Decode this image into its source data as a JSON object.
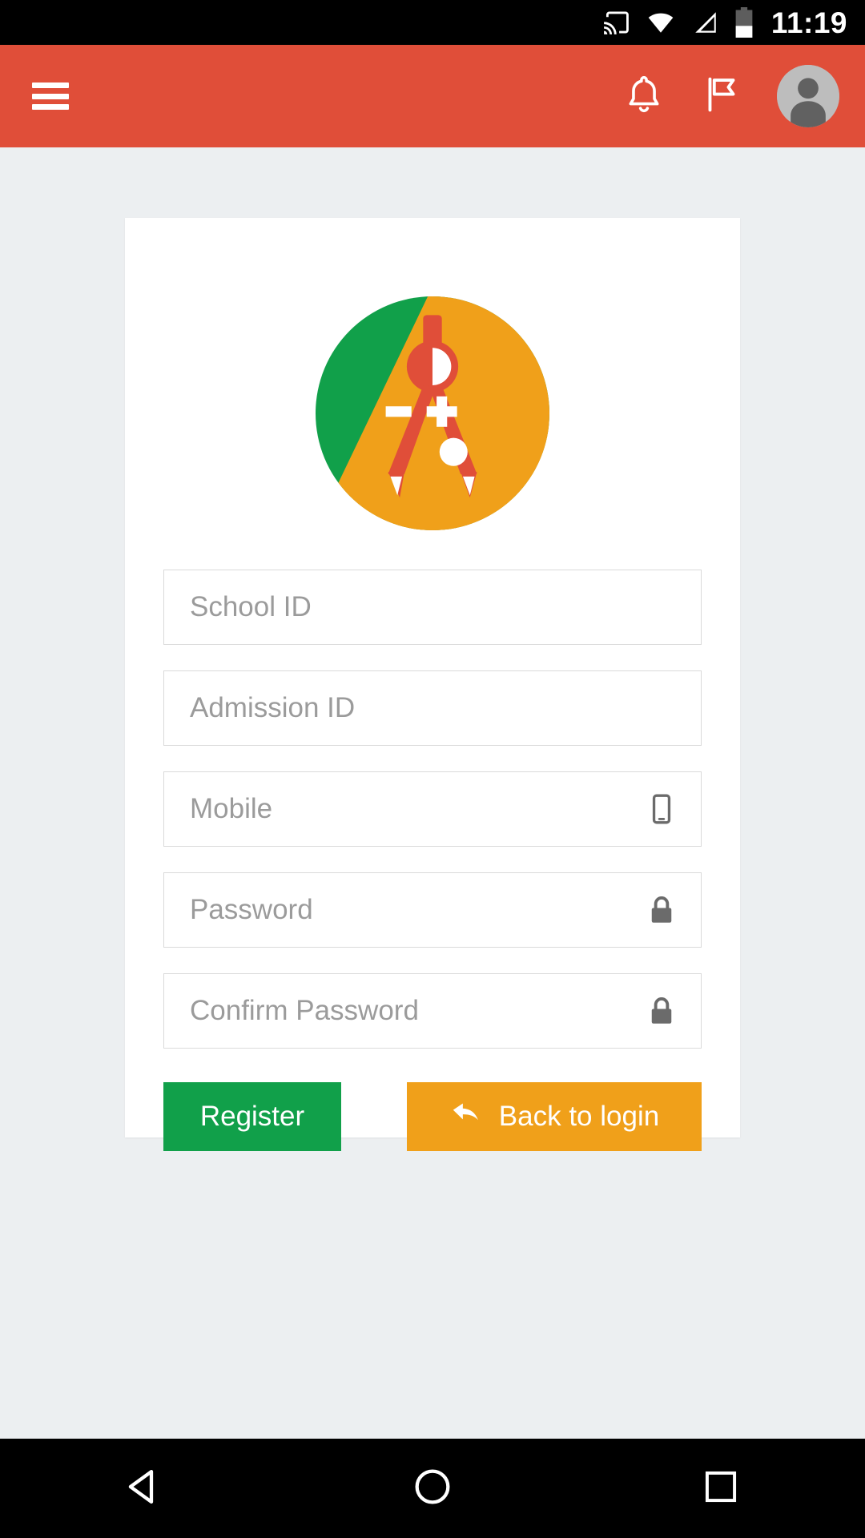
{
  "status_bar": {
    "time": "11:19",
    "icons": [
      "cast-icon",
      "wifi-icon",
      "signal-icon",
      "battery-icon"
    ],
    "battery_level_percent": 40,
    "background_color": "#000000"
  },
  "app_bar": {
    "background_color": "#e04e39",
    "menu_icon": "hamburger-menu-icon",
    "actions": [
      {
        "icon": "notification-bell-icon"
      },
      {
        "icon": "flag-icon"
      },
      {
        "icon": "user-avatar-icon"
      }
    ]
  },
  "card": {
    "logo": {
      "name": "compass-logo",
      "green": "#11a04a",
      "orange": "#f0a01a",
      "red": "#e04e39"
    },
    "fields": [
      {
        "name": "school-id",
        "placeholder": "School ID",
        "value": "",
        "type": "text",
        "icon": null
      },
      {
        "name": "admission-id",
        "placeholder": "Admission ID",
        "value": "",
        "type": "text",
        "icon": null
      },
      {
        "name": "mobile",
        "placeholder": "Mobile",
        "value": "",
        "type": "tel",
        "icon": "mobile-phone-icon"
      },
      {
        "name": "password",
        "placeholder": "Password",
        "value": "",
        "type": "password",
        "icon": "lock-icon"
      },
      {
        "name": "confirm-password",
        "placeholder": "Confirm Password",
        "value": "",
        "type": "password",
        "icon": "lock-icon"
      }
    ],
    "buttons": {
      "register": {
        "label": "Register",
        "color": "#11a04a"
      },
      "back_to_login": {
        "label": "Back to login",
        "color": "#f0a01a",
        "icon": "back-arrow-icon"
      }
    }
  },
  "nav_bar": {
    "background_color": "#000000",
    "buttons": [
      {
        "name": "back-button",
        "icon": "triangle-back-icon"
      },
      {
        "name": "home-button",
        "icon": "circle-home-icon"
      },
      {
        "name": "recents-button",
        "icon": "square-recents-icon"
      }
    ]
  }
}
